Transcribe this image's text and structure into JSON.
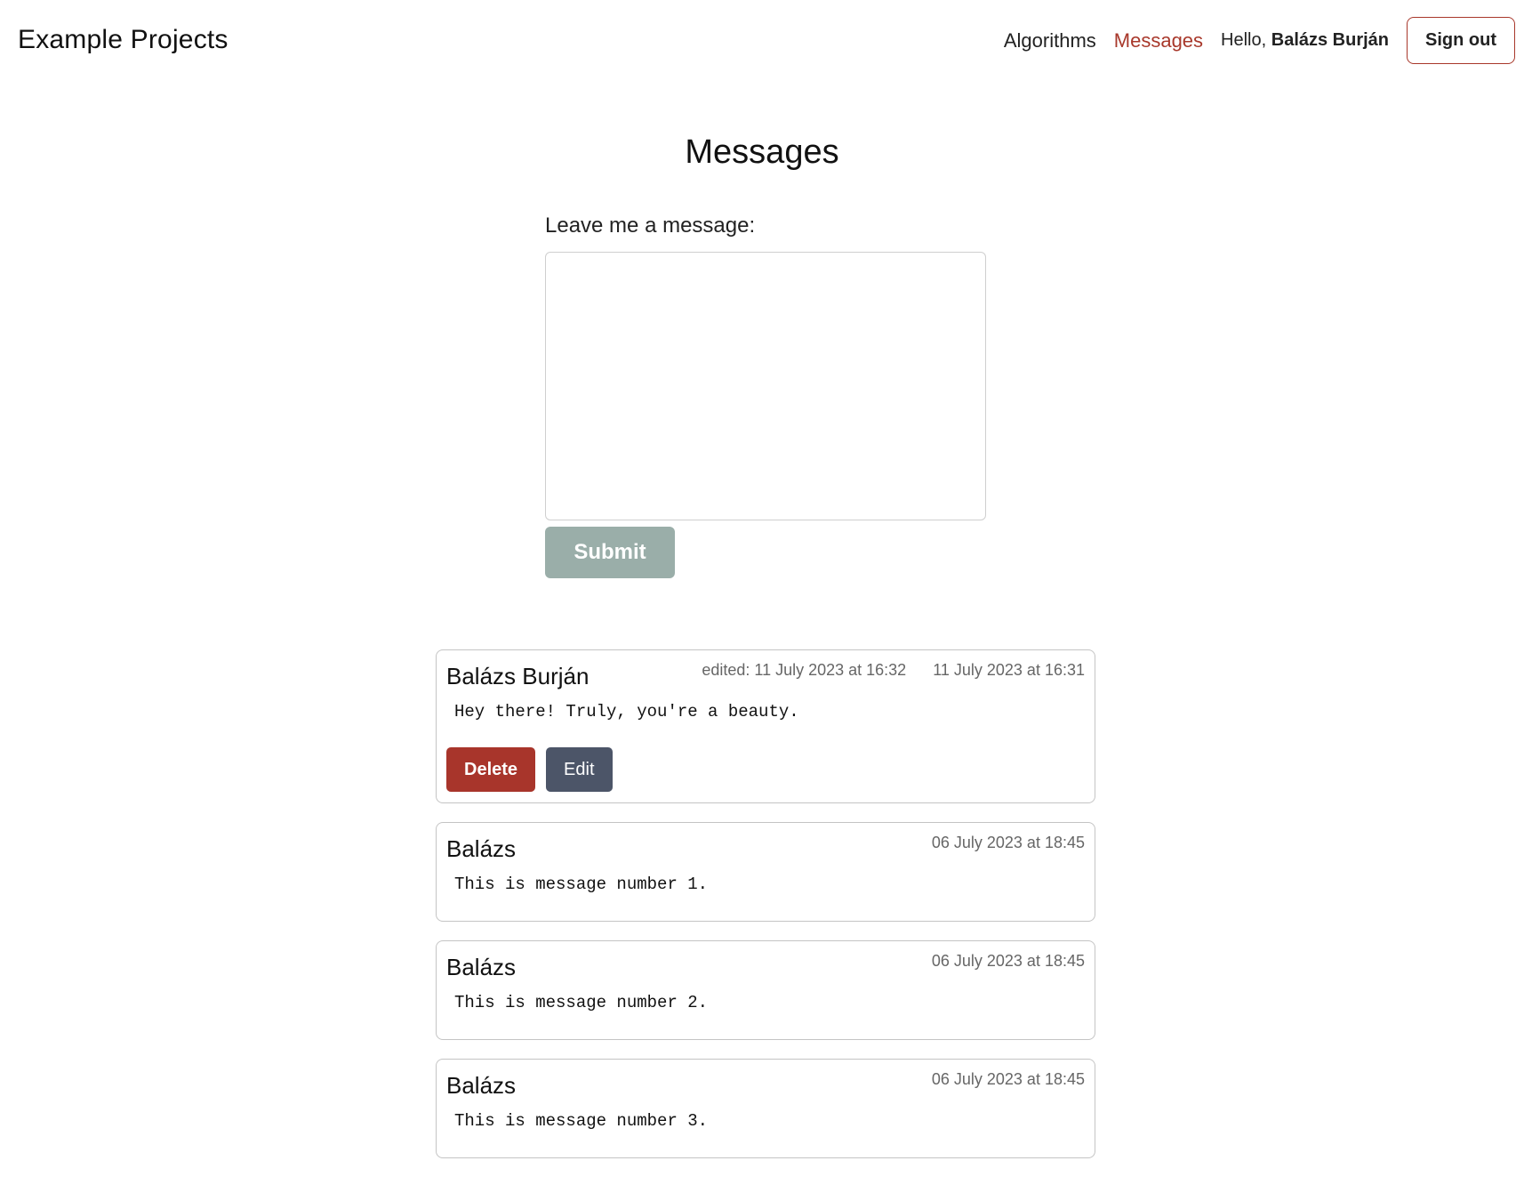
{
  "navbar": {
    "brand": "Example Projects",
    "links": [
      {
        "label": "Algorithms",
        "active": false
      },
      {
        "label": "Messages",
        "active": true
      }
    ],
    "greeting_prefix": "Hello,",
    "username": "Balázs Burján",
    "signout_label": "Sign out"
  },
  "colors": {
    "accent": "#a8382b",
    "submit_bg": "#9aaea9",
    "delete_bg": "#a8352b",
    "edit_bg": "#4c5568"
  },
  "main": {
    "title": "Messages",
    "form_label": "Leave me a message:",
    "message_value": "",
    "submit_label": "Submit"
  },
  "messages": [
    {
      "author": "Balázs Burján",
      "edited": "edited: 11 July 2023 at 16:32",
      "date": "11 July 2023 at 16:31",
      "text": "Hey there! Truly, you're a beauty.",
      "delete_label": "Delete",
      "edit_label": "Edit"
    },
    {
      "author": "Balázs",
      "date": "06 July 2023 at 18:45",
      "text": "This is message number 1."
    },
    {
      "author": "Balázs",
      "date": "06 July 2023 at 18:45",
      "text": "This is message number 2."
    },
    {
      "author": "Balázs",
      "date": "06 July 2023 at 18:45",
      "text": "This is message number 3."
    }
  ]
}
